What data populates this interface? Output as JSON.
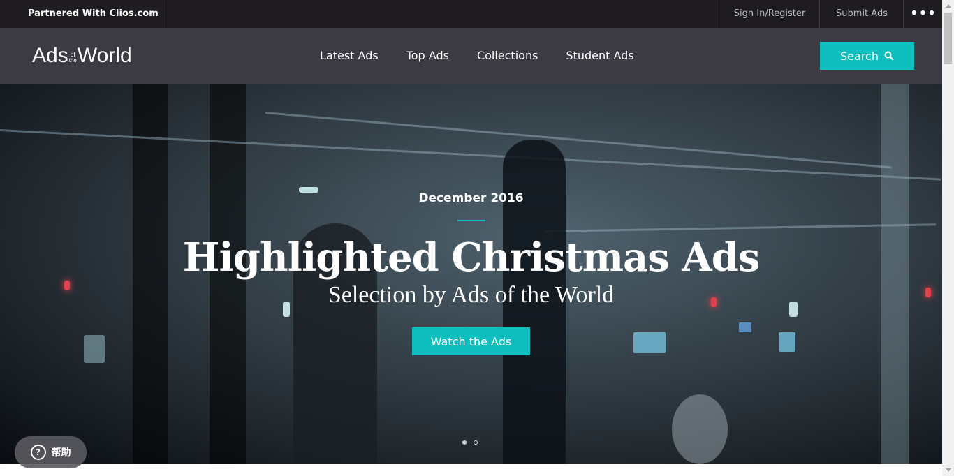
{
  "topbar": {
    "partner": "Partnered With Clios.com",
    "sign_in": "Sign In/Register",
    "submit": "Submit Ads",
    "more": "•••"
  },
  "header": {
    "logo": {
      "main_left": "Ads",
      "small_top": "of",
      "small_bottom": "the",
      "main_right": "World"
    },
    "nav": [
      "Latest Ads",
      "Top Ads",
      "Collections",
      "Student Ads"
    ],
    "search_label": "Search",
    "search_icon": "search-icon"
  },
  "hero": {
    "date": "December 2016",
    "title": "Highlighted Christmas Ads",
    "subtitle": "Selection by Ads of the World",
    "button": "Watch the Ads",
    "slides": {
      "count": 2,
      "active": 1
    }
  },
  "help": {
    "label": "帮助",
    "icon": "question-icon"
  },
  "colors": {
    "accent": "#0fbfbf",
    "nav_bg": "#3c3b44",
    "topbar_bg": "#1e1c21"
  }
}
